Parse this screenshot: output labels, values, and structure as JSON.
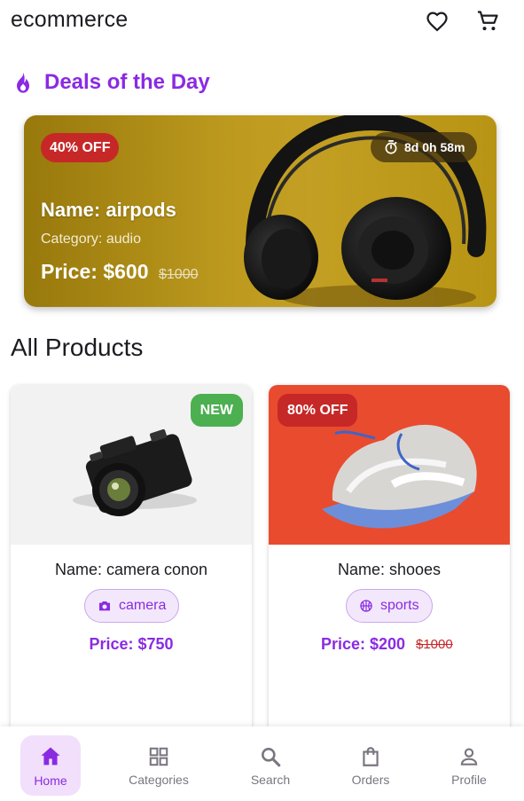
{
  "app": {
    "title": "ecommerce"
  },
  "appbar": {
    "favorite_icon": "heart-outline-icon",
    "cart_icon": "cart-icon"
  },
  "deals": {
    "title": "Deals of the Day",
    "icon": "fire-icon",
    "card": {
      "badge": "40% OFF",
      "timer": "8d 0h 58m",
      "name": "Name: airpods",
      "category": "Category: audio",
      "price": "Price: $600",
      "old_price": "$1000"
    }
  },
  "products": {
    "title": "All Products",
    "items": [
      {
        "badge": "NEW",
        "name": "Name: camera conon",
        "category": "camera",
        "category_icon": "camera-icon",
        "price": "Price: $750",
        "old_price": ""
      },
      {
        "badge": "80% OFF",
        "name": "Name: shooes",
        "category": "sports",
        "category_icon": "basketball-icon",
        "price": "Price: $200",
        "old_price": "$1000"
      }
    ]
  },
  "nav": {
    "items": [
      {
        "label": "Home",
        "icon": "home-icon",
        "active": true
      },
      {
        "label": "Categories",
        "icon": "grid-icon",
        "active": false
      },
      {
        "label": "Search",
        "icon": "search-icon",
        "active": false
      },
      {
        "label": "Orders",
        "icon": "shopping-bag-icon",
        "active": false
      },
      {
        "label": "Profile",
        "icon": "person-icon",
        "active": false
      }
    ]
  },
  "colors": {
    "accent": "#8a2be2",
    "sale": "#c62828",
    "new": "#4caf50",
    "nav_active_bg": "#f1dffb"
  }
}
